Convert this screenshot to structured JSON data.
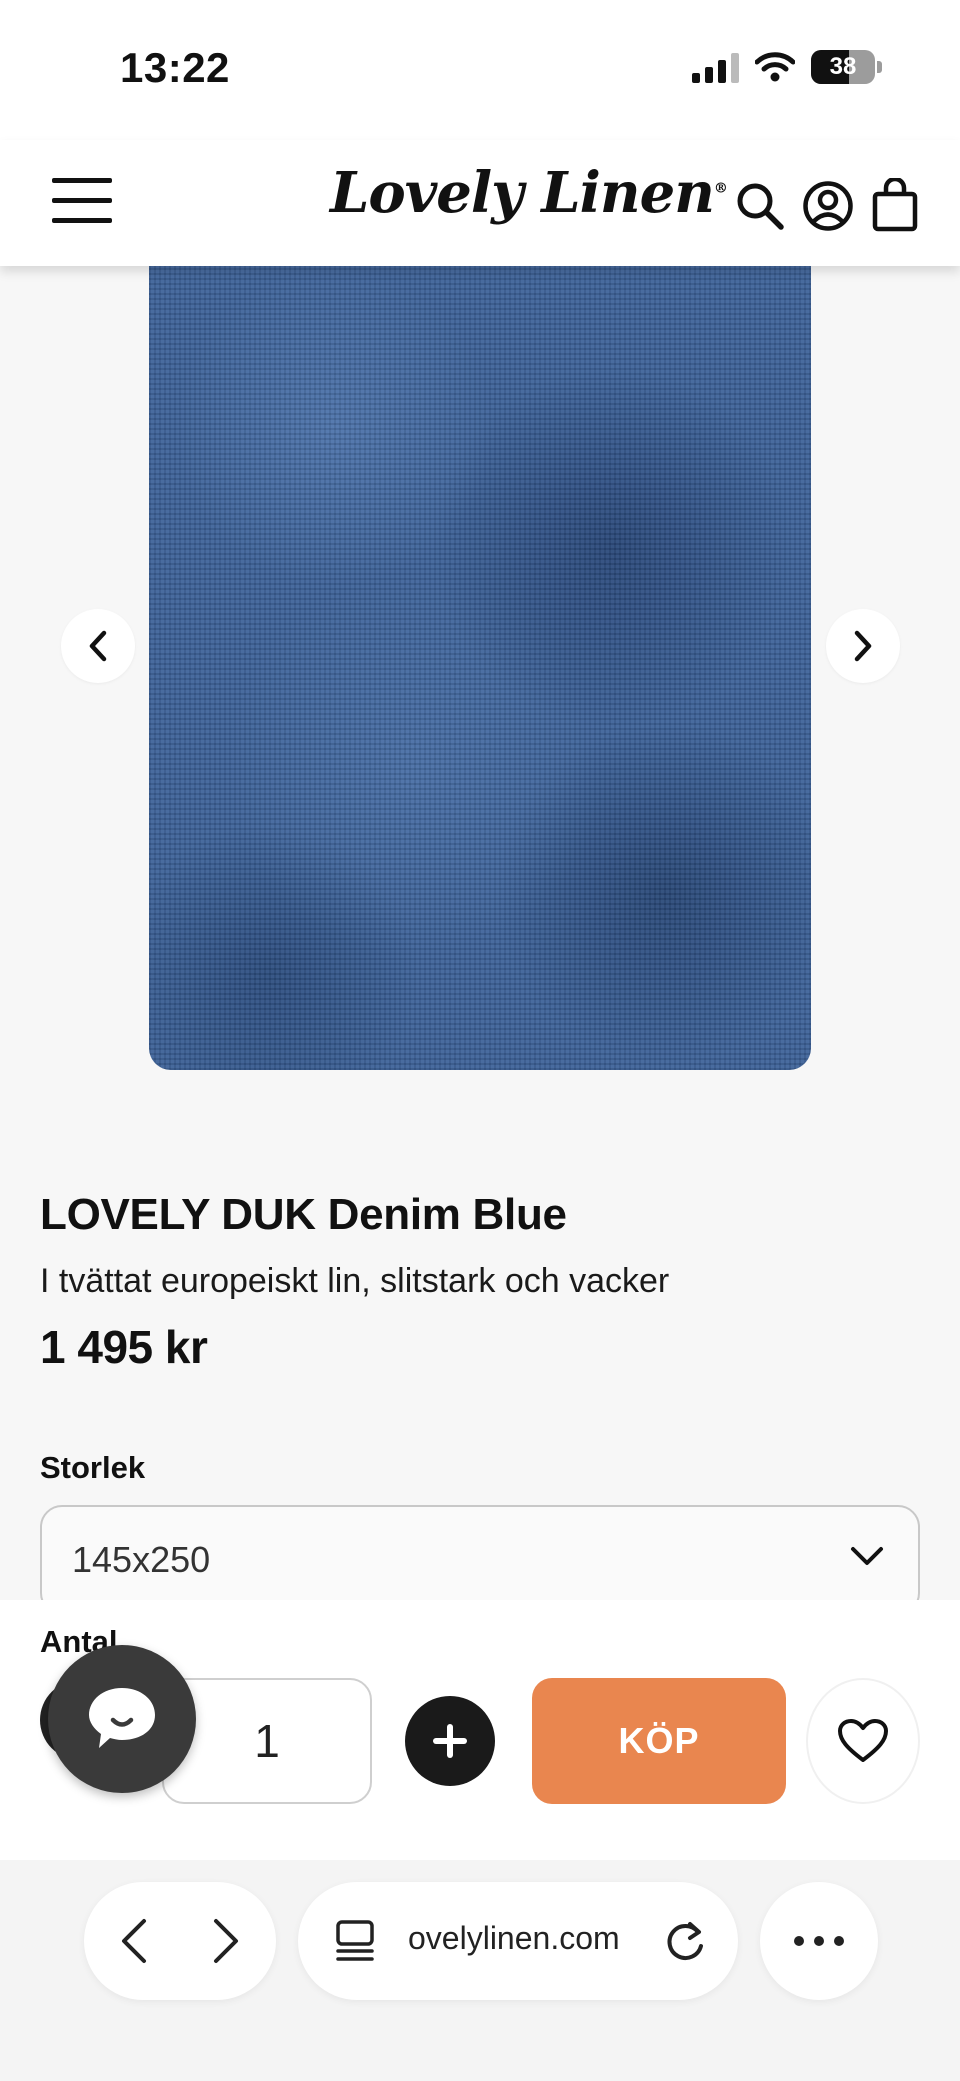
{
  "status_bar": {
    "time": "13:22",
    "battery": "38"
  },
  "header": {
    "logo": "Lovely Linen"
  },
  "product": {
    "title": "LOVELY DUK Denim Blue",
    "subtitle": "I tvättat europeiskt lin, slitstark och vacker",
    "price": "1 495 kr",
    "image_color": "#3d6299"
  },
  "options": {
    "size_label": "Storlek",
    "size_value": "145x250"
  },
  "purchase": {
    "quantity_label": "Antal",
    "quantity": "1",
    "buy_label": "KÖP",
    "buy_color": "#e9864f"
  },
  "browser": {
    "url": "ovelylinen.com"
  },
  "icons": {
    "menu": "menu-icon",
    "search": "search-icon",
    "account": "account-icon",
    "cart": "bag-icon",
    "prev": "chevron-left-icon",
    "next": "chevron-right-icon",
    "dropdown": "chevron-down-icon",
    "plus": "plus-icon",
    "heart": "heart-icon",
    "chat": "chat-icon",
    "tabs": "tabs-icon",
    "reload": "reload-icon",
    "more": "more-icon"
  }
}
